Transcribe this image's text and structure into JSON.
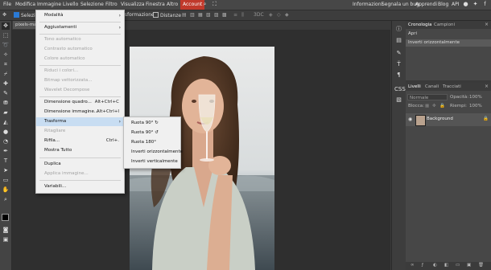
{
  "menubar": {
    "items": [
      "File",
      "Modifica",
      "Immagine",
      "Livello",
      "Selezione",
      "Filtro",
      "Visualizza",
      "Finestra",
      "Altro",
      "Account"
    ],
    "right_links": [
      "Informazioni",
      "Segnala un bug",
      "Apprendi",
      "Blog",
      "API"
    ]
  },
  "options": {
    "auto_select": "Selezio",
    "transform": "Trasformazione",
    "distances": "Distanze",
    "mode_3d": "3DC"
  },
  "document": {
    "tab": "pixels-ma"
  },
  "image_menu": {
    "items": [
      {
        "label": "Modalità",
        "arrow": "›",
        "disabled": false
      },
      {
        "label": "Aggiustamenti",
        "arrow": "›",
        "disabled": false
      },
      {
        "label": "Tono automatico",
        "disabled": true
      },
      {
        "label": "Contrasto automatico",
        "disabled": true
      },
      {
        "label": "Colore automatico",
        "disabled": true
      },
      {
        "label": "Riduci i colori...",
        "disabled": true
      },
      {
        "label": "Bitmap vettorizzata...",
        "disabled": true
      },
      {
        "label": "Wavelet Decompose",
        "disabled": true
      },
      {
        "label": "Dimensione quadro...",
        "shortcut": "Alt+Ctrl+C",
        "disabled": false
      },
      {
        "label": "Dimensione immagine...",
        "shortcut": "Alt+Ctrl+I",
        "disabled": false
      },
      {
        "label": "Trasforma",
        "arrow": "›",
        "disabled": false,
        "highlighted": true
      },
      {
        "label": "Ritagliare",
        "disabled": true
      },
      {
        "label": "Rifila...",
        "shortcut": "Ctrl+.",
        "disabled": false
      },
      {
        "label": "Mostra Tutto",
        "disabled": false
      },
      {
        "label": "Duplica",
        "disabled": false
      },
      {
        "label": "Applica immagine...",
        "disabled": true
      },
      {
        "label": "Variabili...",
        "disabled": false
      }
    ]
  },
  "transform_menu": {
    "items": [
      "Ruota 90° ↻",
      "Ruota 90° ↺",
      "Ruota 180°",
      "Inverti orizzontalmente",
      "Inverti verticalmente"
    ]
  },
  "history_panel": {
    "tabs": [
      "Cronologia",
      "Campioni"
    ],
    "rows": [
      "Apri",
      "Inverti orizzontalmente"
    ]
  },
  "layers_panel": {
    "tabs": [
      "Livelli",
      "Canali",
      "Tracciati"
    ],
    "blend_mode": "Normale",
    "opacity_label": "Opacità:",
    "opacity": "100%",
    "lock_label": "Blocca:",
    "fill_label": "Riempi:",
    "fill": "100%",
    "layer_name": "Background"
  },
  "colors": {
    "accent": "#c0392b",
    "menu_highlight": "#c8ddf2",
    "selection_blue": "#2a7ad5"
  }
}
